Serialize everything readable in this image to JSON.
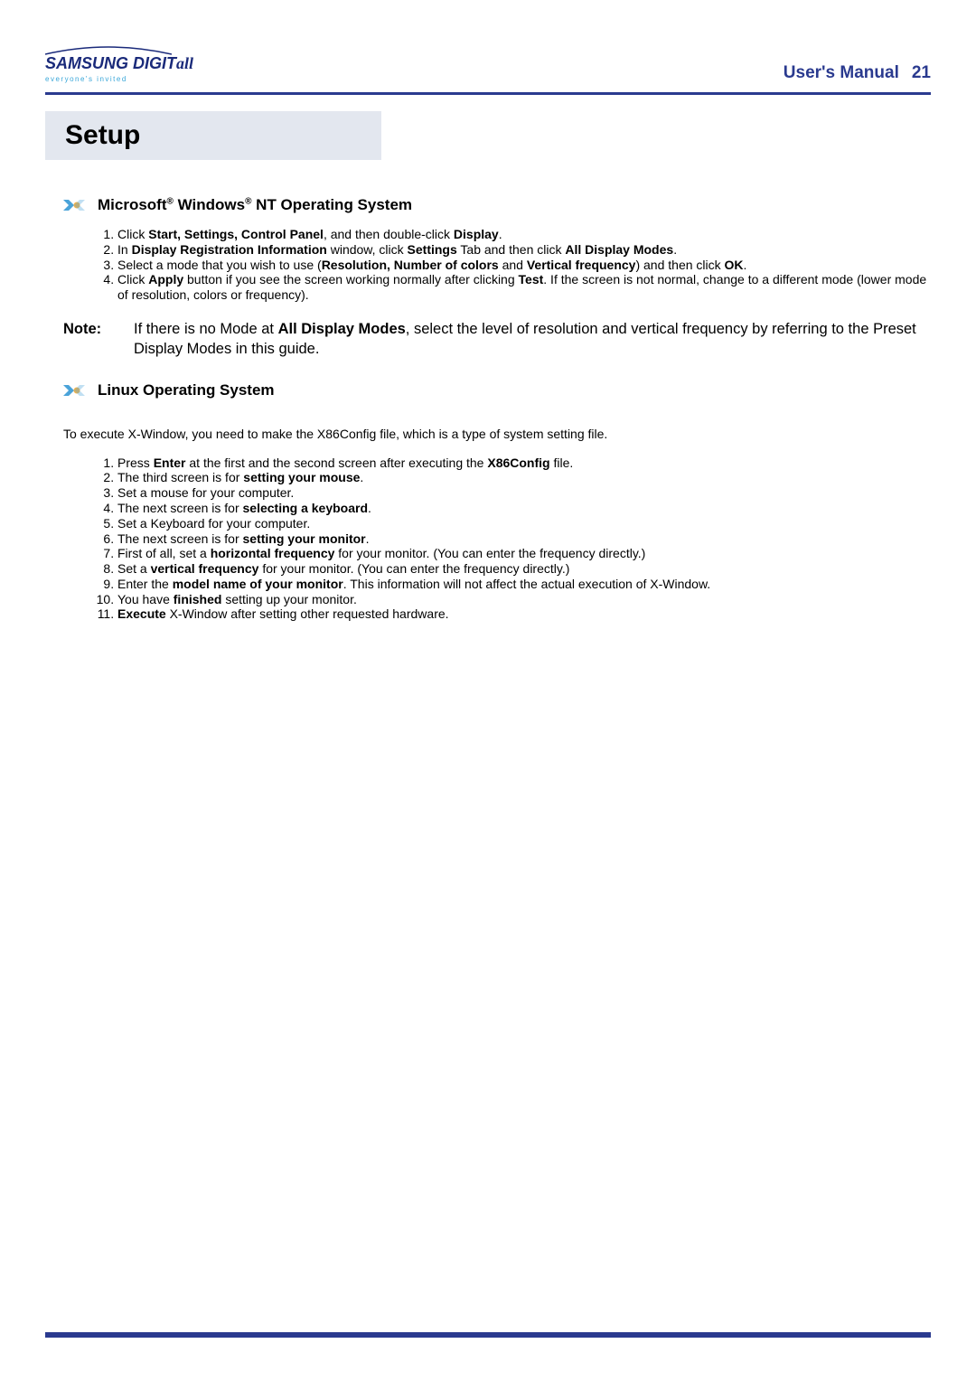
{
  "header": {
    "logo_main_1": "SAMSUNG DIGIT",
    "logo_main_2": "all",
    "logo_sub": "everyone's invited",
    "title": "User's Manual",
    "page_number": "21"
  },
  "section_title": "Setup",
  "os1": {
    "heading_pre": "Microsoft",
    "heading_mid": " Windows",
    "heading_post": " NT Operating System",
    "reg": "®",
    "step1_a": "Click ",
    "step1_b": "Start, Settings, Control Panel",
    "step1_c": ", and then double-click ",
    "step1_d": "Display",
    "step1_e": ".",
    "step2_a": "In ",
    "step2_b": "Display Registration Information",
    "step2_c": " window, click ",
    "step2_d": "Settings",
    "step2_e": " Tab and then click ",
    "step2_f": "All Display Modes",
    "step2_g": ".",
    "step3_a": "Select a mode that you wish to use (",
    "step3_b": "Resolution, Number of colors",
    "step3_c": " and ",
    "step3_d": "Vertical frequency",
    "step3_e": ") and then click ",
    "step3_f": "OK",
    "step3_g": ".",
    "step4_a": "Click ",
    "step4_b": "Apply",
    "step4_c": " button if you see the screen working normally after clicking ",
    "step4_d": "Test",
    "step4_e": ". If the screen is not normal, change to a different mode (lower mode of resolution, colors or frequency)."
  },
  "note": {
    "label": "Note:",
    "body_a": "If there is no Mode at ",
    "body_b": "All Display Modes",
    "body_c": ", select the level of resolution and vertical frequency by referring to the Preset Display Modes in this guide."
  },
  "os2": {
    "heading": "Linux Operating System",
    "intro": "To execute X-Window, you need to make the X86Config file, which is a type of system setting file.",
    "s1_a": "Press ",
    "s1_b": "Enter",
    "s1_c": " at the first and the second screen after executing the ",
    "s1_d": "X86Config",
    "s1_e": " file.",
    "s2_a": "The third screen is for ",
    "s2_b": "setting your mouse",
    "s2_c": ".",
    "s3": "Set a mouse for your computer.",
    "s4_a": "The next screen is for ",
    "s4_b": "selecting a keyboard",
    "s4_c": ".",
    "s5": "Set a Keyboard for your computer.",
    "s6_a": "The next screen is for ",
    "s6_b": "setting your monitor",
    "s6_c": ".",
    "s7_a": "First of all, set a ",
    "s7_b": "horizontal frequency",
    "s7_c": " for your monitor. (You can enter the frequency directly.)",
    "s8_a": "Set a ",
    "s8_b": "vertical frequency",
    "s8_c": " for your monitor. (You can enter the frequency directly.)",
    "s9_a": "Enter the ",
    "s9_b": "model name of your monitor",
    "s9_c": ". This information will not affect the actual execution of X-Window.",
    "s10_a": "You have ",
    "s10_b": "finished",
    "s10_c": " setting up your monitor.",
    "s11_b": "Execute",
    "s11_c": " X-Window after setting other requested hardware."
  }
}
